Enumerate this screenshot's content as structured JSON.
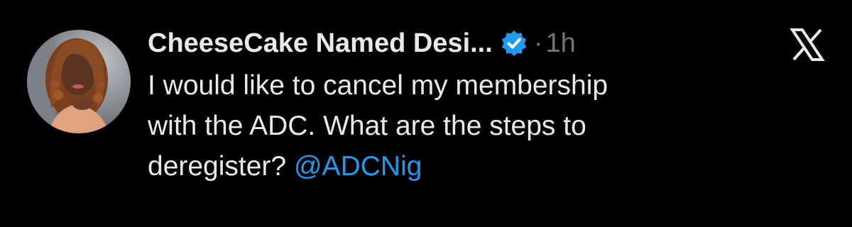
{
  "tweet": {
    "display_name": "CheeseCake Named Desi...",
    "separator": "·",
    "timestamp": "1h",
    "body_lines": [
      "I would like to cancel my membership",
      "with the ADC. What are the steps to",
      "deregister?"
    ],
    "mention": "@ADCNig"
  },
  "icons": {
    "verified": "verified-badge-icon",
    "close": "x-close-icon",
    "avatar": "profile-photo"
  },
  "colors": {
    "background": "#000000",
    "text": "#e7e9ea",
    "muted": "#71767b",
    "accent": "#1d9bf0"
  }
}
